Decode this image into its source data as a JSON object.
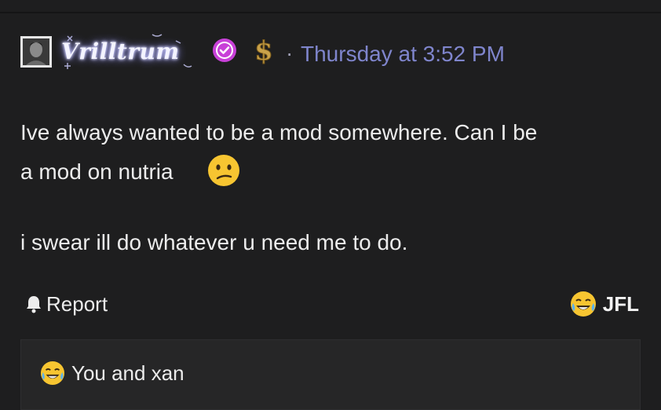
{
  "post": {
    "author": {
      "username": "Vrilltrum",
      "verified_badge": "verified-check-icon",
      "donor_badge": "dollar-icon",
      "accent_username_glow": "#c7c7ff"
    },
    "separator": "·",
    "timestamp": "Thursday at 3:52 PM",
    "colors": {
      "background": "#1e1e1f",
      "timestamp": "#7f85cc",
      "verified": "#c840d8"
    },
    "body": {
      "line1": "Ive always wanted to be a mod somewhere. Can I be",
      "line2": "a mod on nutria",
      "line2_emoji": "confused-face-icon",
      "line3": "i swear ill do whatever u need me to do."
    },
    "actions": {
      "report_label": "Report",
      "report_icon": "bell-icon"
    },
    "reaction": {
      "icon": "joy-face-icon",
      "label": "JFL",
      "summary_text": "You and xan"
    }
  }
}
